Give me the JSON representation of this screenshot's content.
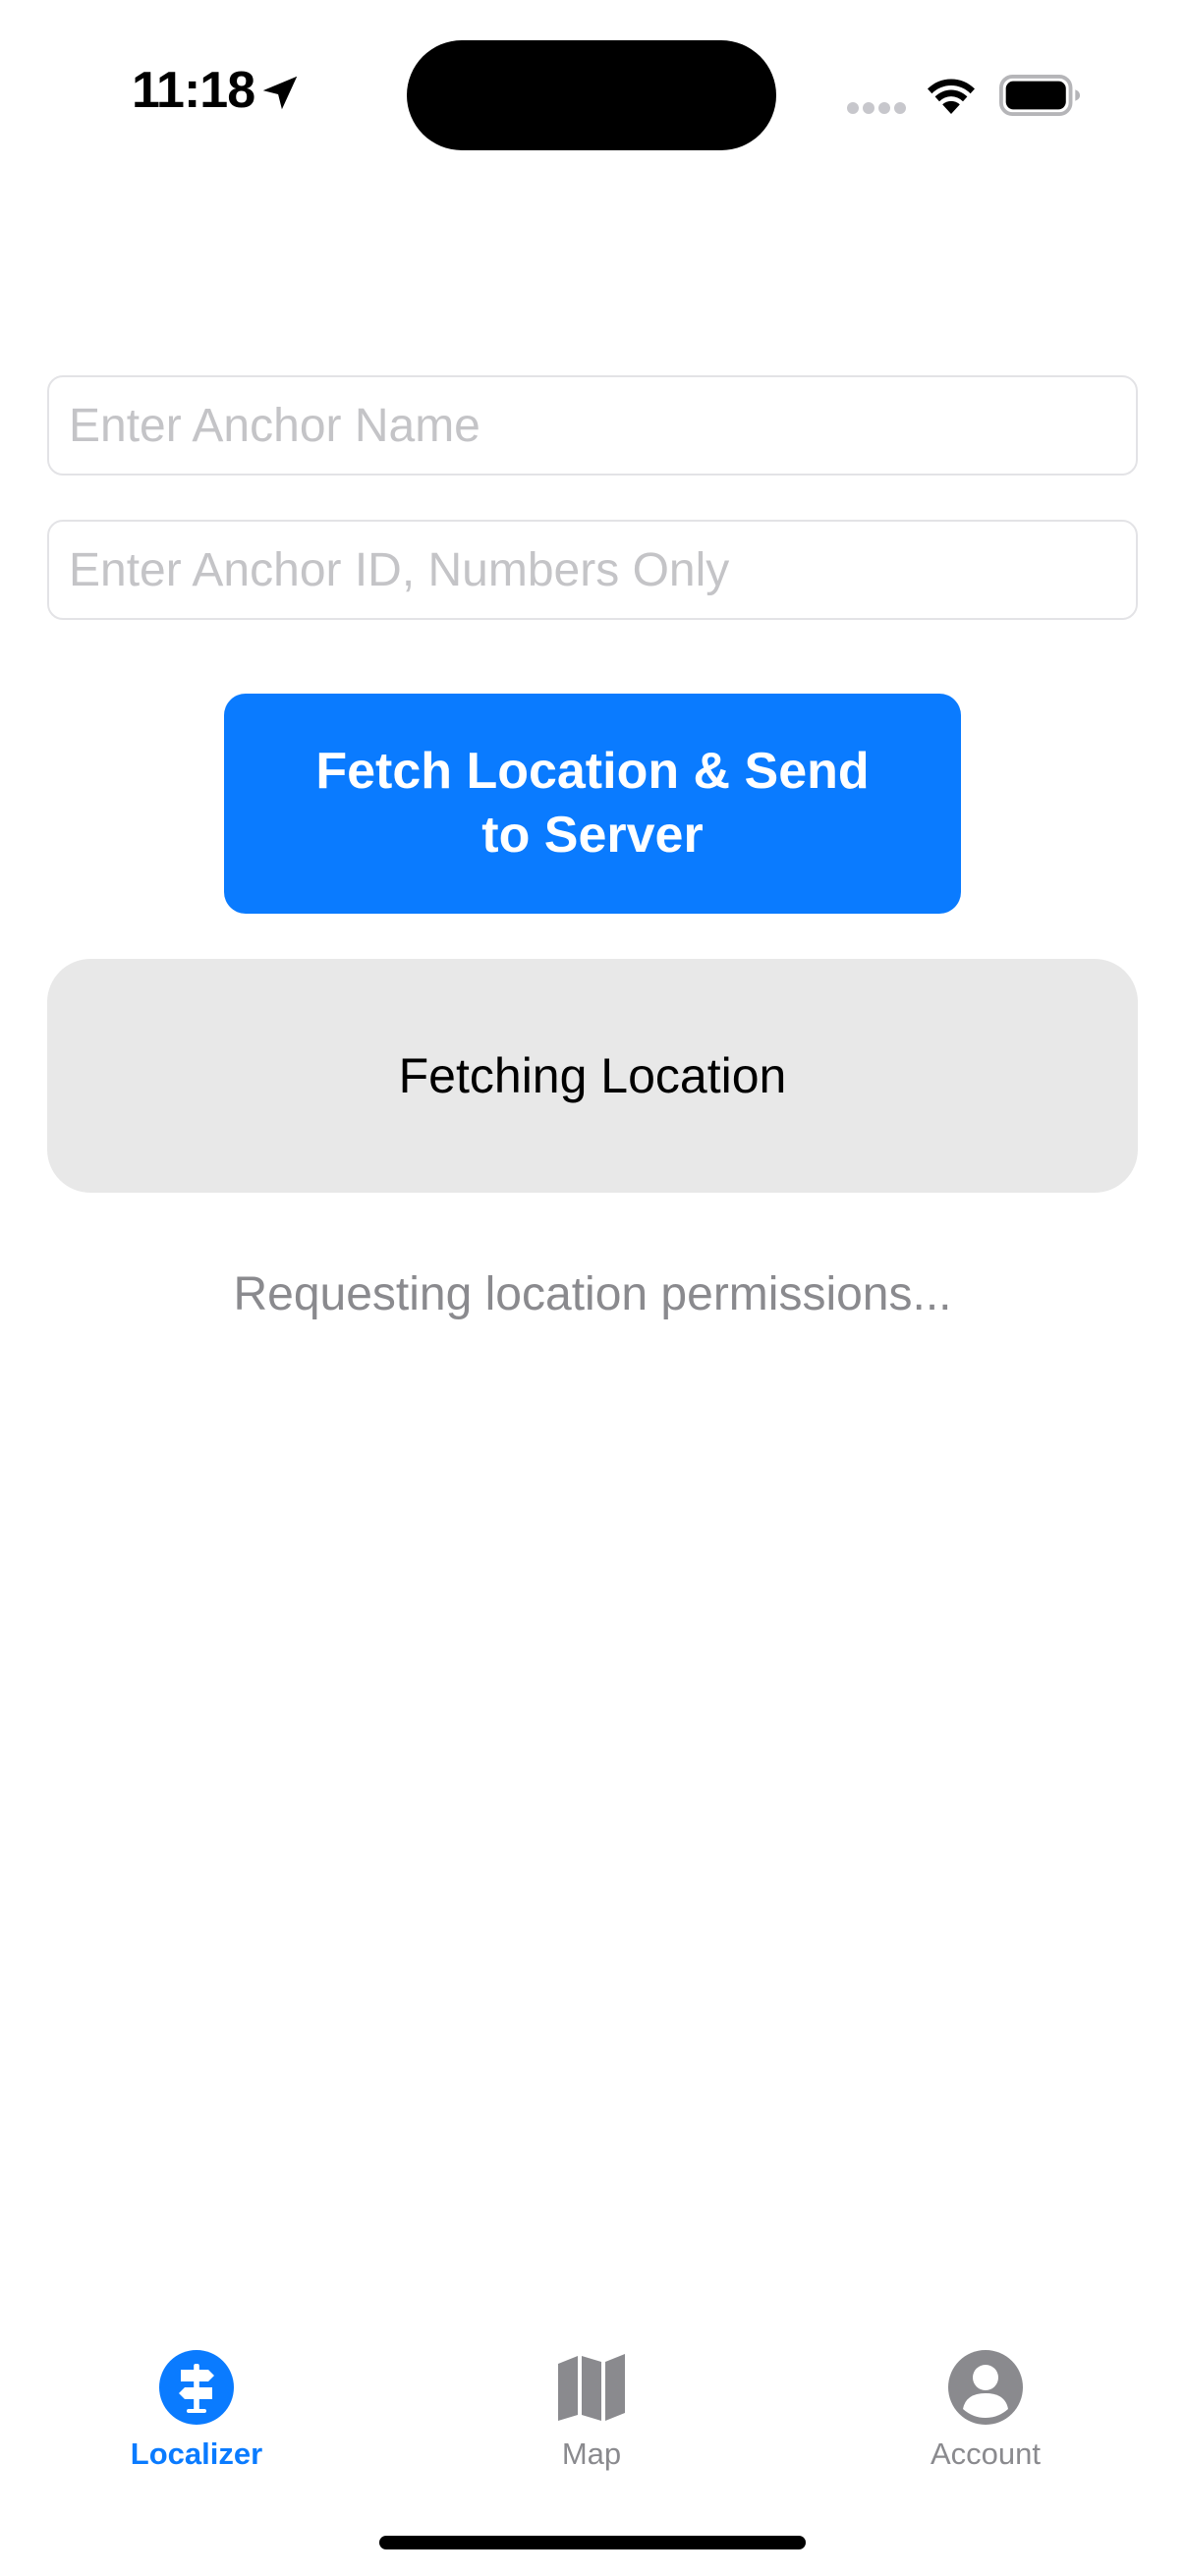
{
  "status_bar": {
    "time": "11:18",
    "icons": [
      "location-arrow-icon",
      "cellular-signal-icon",
      "wifi-icon",
      "battery-icon"
    ]
  },
  "form": {
    "anchor_name_placeholder": "Enter Anchor Name",
    "anchor_name_value": "",
    "anchor_id_placeholder": "Enter Anchor ID, Numbers Only",
    "anchor_id_value": "",
    "submit_label": "Fetch Location & Send to Server"
  },
  "status_card": {
    "label": "Fetching Location"
  },
  "status_message": "Requesting location permissions...",
  "tab_bar": {
    "active_tab": "Localizer",
    "tabs": [
      {
        "label": "Localizer",
        "icon": "signpost-icon"
      },
      {
        "label": "Map",
        "icon": "map-icon"
      },
      {
        "label": "Account",
        "icon": "person-circle-icon"
      }
    ]
  },
  "colors": {
    "accent": "#0a7bff",
    "card_background": "#e8e8e8",
    "secondary_text": "#8a8a8e",
    "placeholder": "#c4c4c7"
  }
}
